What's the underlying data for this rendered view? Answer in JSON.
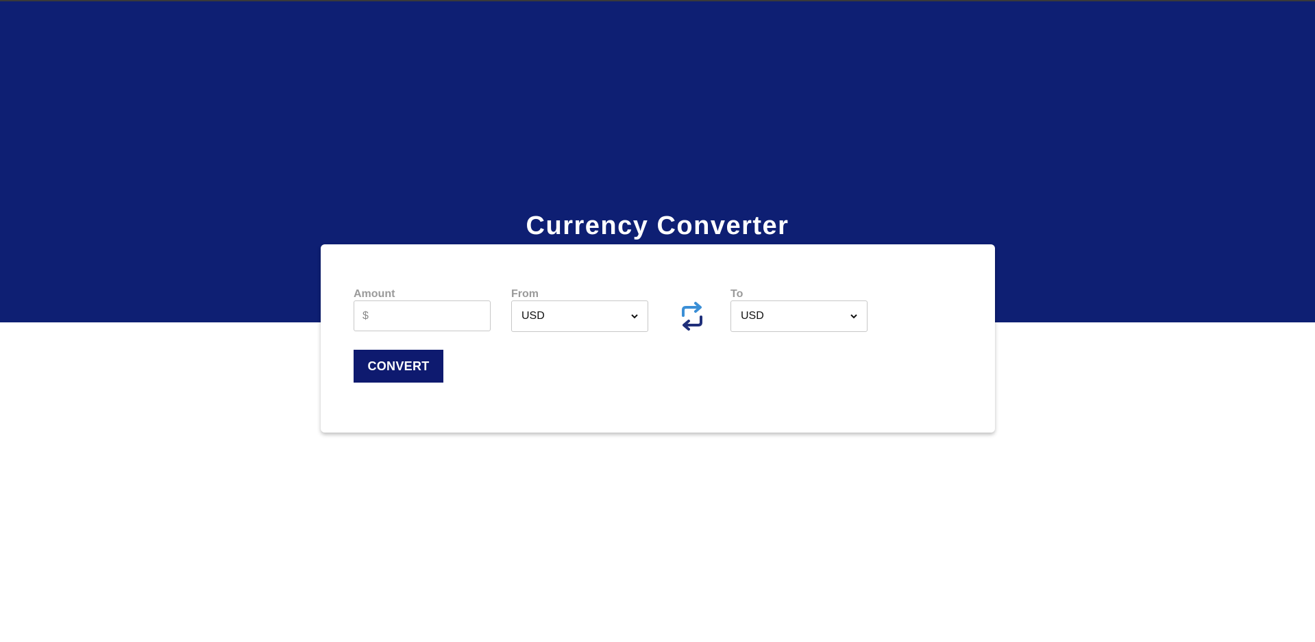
{
  "app": {
    "title": "Currency Converter"
  },
  "colors": {
    "hero_background": "#0e1f73",
    "button_background": "#0e1a6f",
    "swap_icon_top": "#3b8fd6",
    "swap_icon_bottom": "#1f2f7a"
  },
  "form": {
    "amount": {
      "label": "Amount",
      "value": "",
      "placeholder": "$"
    },
    "from": {
      "label": "From",
      "selected": "USD"
    },
    "to": {
      "label": "To",
      "selected": "USD"
    },
    "swap_icon": "swap-arrows-icon",
    "convert_label": "CONVERT"
  }
}
